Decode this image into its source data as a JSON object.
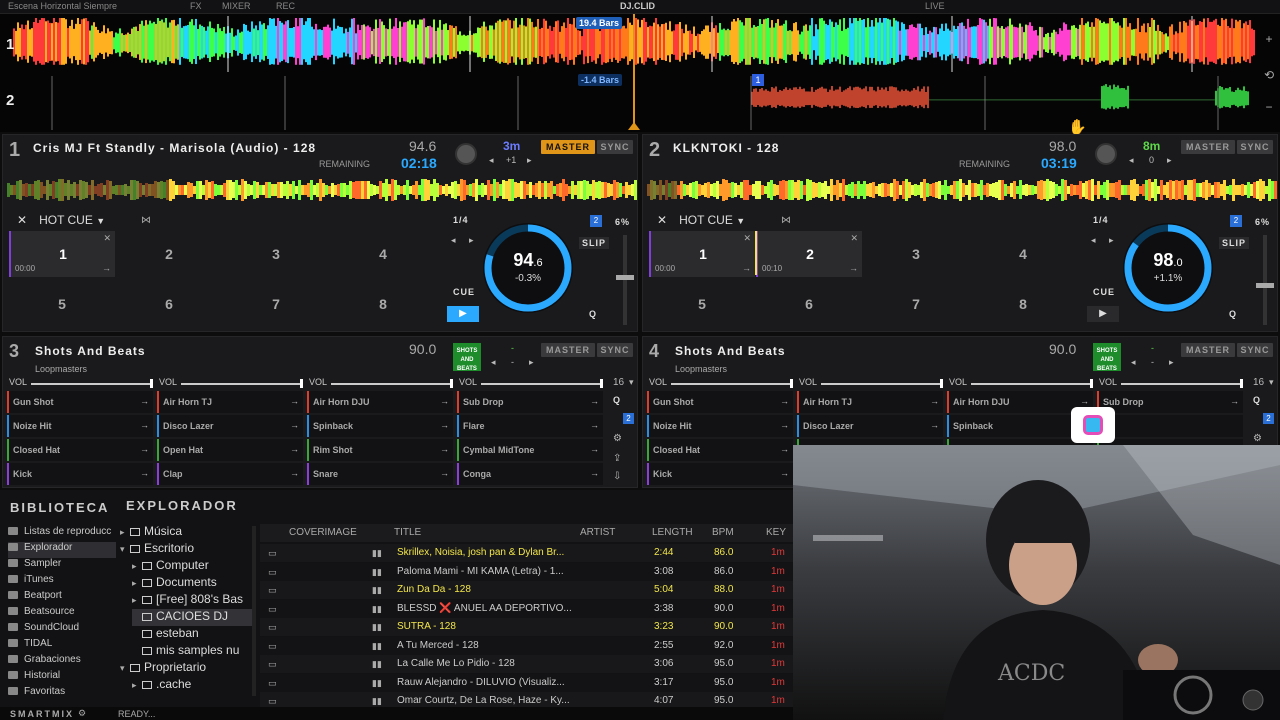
{
  "topbar": {
    "left_text": "Escena Horizontal   Siempre",
    "tabs": [
      "FX",
      "MIXER",
      "REC"
    ],
    "logo": "DJ.CLID",
    "right_text": "LIVE"
  },
  "waveform": {
    "deck1_label": "1",
    "deck2_label": "2",
    "deck1_bars": "19.4 Bars",
    "deck2_bars": "-1.4 Bars",
    "cue_marker": "1"
  },
  "decks": [
    {
      "num": "1",
      "title": "Cris MJ Ft Standly - Marisola (Audio) - 128",
      "bpm": "94.6",
      "remaining_label": "REMAINING",
      "time": "02:18",
      "key": "3m",
      "key_color": "#6b7cff",
      "pitch_offset": "+1",
      "master_label": "MASTER",
      "sync_label": "SYNC",
      "master_on": true,
      "pad_mode": "HOT CUE",
      "loop": "1/4",
      "slip": "SLIP",
      "cue": "CUE",
      "q": "Q",
      "badge": "2",
      "pct": "6%",
      "dial_bpm_main": "94",
      "dial_bpm_dec": ".6",
      "dial_pitch": "-0.3%",
      "dial_fraction": 0.8,
      "pads": [
        {
          "n": "1",
          "time": "00:00",
          "active": true
        },
        {
          "n": "2",
          "time": "",
          "active": false
        },
        {
          "n": "3",
          "time": "",
          "active": false
        },
        {
          "n": "4",
          "time": "",
          "active": false
        },
        {
          "n": "5",
          "time": "",
          "active": false
        },
        {
          "n": "6",
          "time": "",
          "active": false
        },
        {
          "n": "7",
          "time": "",
          "active": false
        },
        {
          "n": "8",
          "time": "",
          "active": false
        }
      ]
    },
    {
      "num": "2",
      "title": "KLKNTOKI - 128",
      "bpm": "98.0",
      "remaining_label": "REMAINING",
      "time": "03:19",
      "key": "8m",
      "key_color": "#5ed84a",
      "pitch_offset": "0",
      "master_label": "MASTER",
      "sync_label": "SYNC",
      "master_on": false,
      "pad_mode": "HOT CUE",
      "loop": "1/4",
      "slip": "SLIP",
      "cue": "CUE",
      "q": "Q",
      "badge": "2",
      "pct": "6%",
      "dial_bpm_main": "98",
      "dial_bpm_dec": ".0",
      "dial_pitch": "+1.1%",
      "dial_fraction": 0.85,
      "pads": [
        {
          "n": "1",
          "time": "00:00",
          "active": true
        },
        {
          "n": "2",
          "time": "00:10",
          "active": true
        },
        {
          "n": "3",
          "time": "",
          "active": false
        },
        {
          "n": "4",
          "time": "",
          "active": false
        },
        {
          "n": "5",
          "time": "",
          "active": false
        },
        {
          "n": "6",
          "time": "",
          "active": false
        },
        {
          "n": "7",
          "time": "",
          "active": false
        },
        {
          "n": "8",
          "time": "",
          "active": false
        }
      ]
    }
  ],
  "sampler_decks": [
    {
      "num": "3",
      "title": "Shots And Beats",
      "artist": "Loopmasters",
      "bpm": "90.0",
      "thumb": "SHOTS AND BEATS",
      "key": "-",
      "offset": "-",
      "master_label": "MASTER",
      "sync_label": "SYNC",
      "vol_label": "VOL",
      "bank": "16",
      "q": "Q",
      "badge": "2",
      "samples": [
        [
          "Gun Shot",
          "Air Horn TJ",
          "Air Horn DJU",
          "Sub Drop"
        ],
        [
          "Noize Hit",
          "Disco Lazer",
          "Spinback",
          "Flare"
        ],
        [
          "Closed Hat",
          "Open Hat",
          "Rim Shot",
          "Cymbal MidTone"
        ],
        [
          "Kick",
          "Clap",
          "Snare",
          "Conga"
        ]
      ]
    },
    {
      "num": "4",
      "title": "Shots And Beats",
      "artist": "Loopmasters",
      "bpm": "90.0",
      "thumb": "SHOTS AND BEATS",
      "key": "-",
      "offset": "-",
      "master_label": "MASTER",
      "sync_label": "SYNC",
      "vol_label": "VOL",
      "bank": "16",
      "q": "Q",
      "badge": "2",
      "samples": [
        [
          "Gun Shot",
          "Air Horn TJ",
          "Air Horn DJU",
          "Sub Drop"
        ],
        [
          "Noize Hit",
          "Disco Lazer",
          "Spinback",
          ""
        ],
        [
          "Closed Hat",
          "",
          "",
          ""
        ],
        [
          "Kick",
          "",
          "",
          ""
        ]
      ]
    }
  ],
  "sample_colors": [
    "#d6402c",
    "#2d8ee0",
    "#3aa63a",
    "#8a3fd6"
  ],
  "browser": {
    "biblioteca": "BIBLIOTECA",
    "explorador": "EXPLORADOR",
    "library": [
      "Listas de reproducc",
      "Explorador",
      "Sampler",
      "iTunes",
      "Beatport",
      "Beatsource",
      "SoundCloud",
      "TIDAL",
      "Grabaciones",
      "Historial",
      "Favoritas"
    ],
    "library_selected": 1,
    "tree": [
      {
        "label": "Música",
        "indent": 0,
        "exp": "▸",
        "sel": false
      },
      {
        "label": "Escritorio",
        "indent": 0,
        "exp": "▾",
        "sel": false
      },
      {
        "label": "Computer",
        "indent": 1,
        "exp": "▸",
        "sel": false
      },
      {
        "label": "Documents",
        "indent": 1,
        "exp": "▸",
        "sel": false
      },
      {
        "label": "[Free] 808's Bas",
        "indent": 1,
        "exp": "▸",
        "sel": false
      },
      {
        "label": "CACIOES DJ",
        "indent": 1,
        "exp": "",
        "sel": true
      },
      {
        "label": "esteban",
        "indent": 1,
        "exp": "",
        "sel": false
      },
      {
        "label": "mis samples nu",
        "indent": 1,
        "exp": "",
        "sel": false
      },
      {
        "label": "Proprietario",
        "indent": 0,
        "exp": "▾",
        "sel": false
      },
      {
        "label": ".cache",
        "indent": 1,
        "exp": "▸",
        "sel": false
      }
    ],
    "columns": [
      "COVERIMAGE",
      "TITLE",
      "ARTIST",
      "LENGTH",
      "BPM",
      "KEY"
    ],
    "tracks": [
      {
        "title": "Skrillex, Noisia, josh pan & Dylan Br...",
        "artist": "",
        "length": "2:44",
        "bpm": "86.0",
        "key": "1m",
        "hl": true
      },
      {
        "title": "Paloma Mami - MI KAMA (Letra) - 1...",
        "artist": "",
        "length": "3:08",
        "bpm": "86.0",
        "key": "1m",
        "hl": false
      },
      {
        "title": "Zun Da Da - 128",
        "artist": "",
        "length": "5:04",
        "bpm": "88.0",
        "key": "1m",
        "hl": true
      },
      {
        "title": "BLESSD ❌ ANUEL AA  DEPORTIVO...",
        "artist": "",
        "length": "3:38",
        "bpm": "90.0",
        "key": "1m",
        "hl": false
      },
      {
        "title": "SUTRA - 128",
        "artist": "",
        "length": "3:23",
        "bpm": "90.0",
        "key": "1m",
        "hl": true
      },
      {
        "title": "A Tu Merced - 128",
        "artist": "",
        "length": "2:55",
        "bpm": "92.0",
        "key": "1m",
        "hl": false
      },
      {
        "title": "La Calle Me Lo Pidio - 128",
        "artist": "",
        "length": "3:06",
        "bpm": "95.0",
        "key": "1m",
        "hl": false
      },
      {
        "title": "Rauw Alejandro - DILUVIO (Visualiz...",
        "artist": "",
        "length": "3:17",
        "bpm": "95.0",
        "key": "1m",
        "hl": false
      },
      {
        "title": "Omar Courtz, De La Rose, Haze - Ky...",
        "artist": "",
        "length": "4:07",
        "bpm": "95.0",
        "key": "1m",
        "hl": false
      }
    ]
  },
  "status": {
    "brand": "SMARTMIX",
    "text": "READY..."
  },
  "colors": {
    "accent_blue": "#2aa9ff",
    "master_orange": "#e09418",
    "highlight_yellow": "#f2e64a",
    "key_red": "#e03a3a"
  }
}
